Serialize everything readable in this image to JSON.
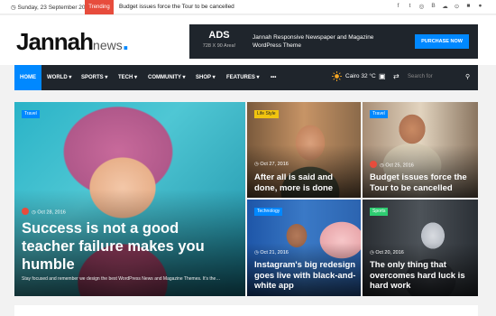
{
  "topbar": {
    "date": "Sunday, 23 September 2018",
    "trending_label": "Trending",
    "ticker_text": "Budget issues force the Tour to be cancelled",
    "social_icons": [
      "facebook-icon",
      "twitter-icon",
      "dribbble-icon",
      "behance-icon",
      "soundcloud-icon",
      "rss-icon",
      "lock-icon",
      "user-icon"
    ]
  },
  "header": {
    "logo_main": "Jannah",
    "logo_sub": "news",
    "logo_dot": ".",
    "ad": {
      "title": "ADS",
      "size": "728 X 90 Area!",
      "text": "Jannah Responsive Newspaper and Magazine WordPress Theme",
      "button": "PURCHASE NOW"
    }
  },
  "nav": {
    "items": [
      "HOME",
      "WORLD ▾",
      "SPORTS ▾",
      "TECH ▾",
      "COMMUNITY ▾",
      "SHOP ▾",
      "FEATURES ▾",
      "•••"
    ],
    "weather": "Cairo 32 °C",
    "search_placeholder": "Search for"
  },
  "featured": {
    "tag": "Travel",
    "date": "Oct 28, 2016",
    "title": "Success is not a good teacher failure makes you humble",
    "excerpt": "Stay focused and remember we design the best WordPress News and Magazine Themes. It's the…"
  },
  "cards": [
    {
      "tag": "Life Style",
      "tag_color": "#f1c40f",
      "date": "Oct 27, 2016",
      "title": "After all is said and done, more is done"
    },
    {
      "tag": "Travel",
      "tag_color": "#0088ff",
      "date": "Oct 25, 2016",
      "title": "Budget issues force the Tour to be cancelled"
    },
    {
      "tag": "Technology",
      "tag_color": "#0088ff",
      "date": "Oct 21, 2016",
      "title": "Instagram's big redesign goes live with black-and-white app"
    },
    {
      "tag": "Sports",
      "tag_color": "#2ecc71",
      "date": "Oct 20, 2016",
      "title": "The only thing that overcomes hard luck is hard work"
    }
  ],
  "colors": {
    "accent": "#0088ff",
    "trend": "#e74c3c",
    "dark": "#1f252c"
  }
}
